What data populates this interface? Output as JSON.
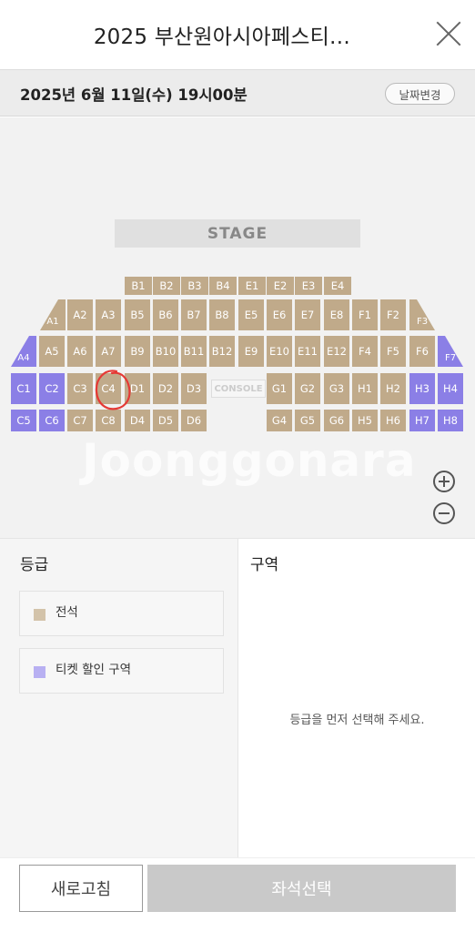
{
  "header": {
    "title": "2025 부산원아시아페스티…",
    "close_icon": "close-icon"
  },
  "datebar": {
    "date": "2025년 6월 11일(수) 19시00분",
    "change_label": "날짜변경"
  },
  "map": {
    "stage_label": "STAGE",
    "console_label": "CONSOLE",
    "watermark": "Joonggonara",
    "colors": {
      "standard": "#c0aa8a",
      "discount": "#8b7fe6",
      "marker": "#e53935"
    },
    "sections": {
      "row1": [
        "B1",
        "B2",
        "B3",
        "B4",
        "E1",
        "E2",
        "E3",
        "E4"
      ],
      "row2": [
        "A1",
        "A2",
        "A3",
        "B5",
        "B6",
        "B7",
        "B8",
        "E5",
        "E6",
        "E7",
        "E8",
        "F1",
        "F2",
        "F3"
      ],
      "row3": [
        "A4",
        "A5",
        "A6",
        "A7",
        "B9",
        "B10",
        "B11",
        "B12",
        "E9",
        "E10",
        "E11",
        "E12",
        "F4",
        "F5",
        "F6",
        "F7"
      ],
      "row4": [
        "C1",
        "C2",
        "C3",
        "C4",
        "D1",
        "D2",
        "D3",
        "G1",
        "G2",
        "G3",
        "H1",
        "H2",
        "H3",
        "H4"
      ],
      "row5": [
        "C5",
        "C6",
        "C7",
        "C8",
        "D4",
        "D5",
        "D6",
        "G4",
        "G5",
        "G6",
        "H5",
        "H6",
        "H7",
        "H8"
      ]
    },
    "discount_sections": [
      "A4",
      "F7",
      "C1",
      "C2",
      "C5",
      "C6",
      "H3",
      "H4",
      "H7",
      "H8"
    ],
    "marked_section": "C4",
    "zoom_in_icon": "plus-circle-icon",
    "zoom_out_icon": "minus-circle-icon"
  },
  "grades": {
    "title": "등급",
    "items": [
      {
        "label": "전석",
        "color": "#d3c3aa"
      },
      {
        "label": "티켓 할인 구역",
        "color": "#b8b0f2"
      }
    ]
  },
  "zone": {
    "title": "구역",
    "hint": "등급을 먼저 선택해 주세요."
  },
  "footer": {
    "refresh_label": "새로고침",
    "select_label": "좌석선택"
  }
}
